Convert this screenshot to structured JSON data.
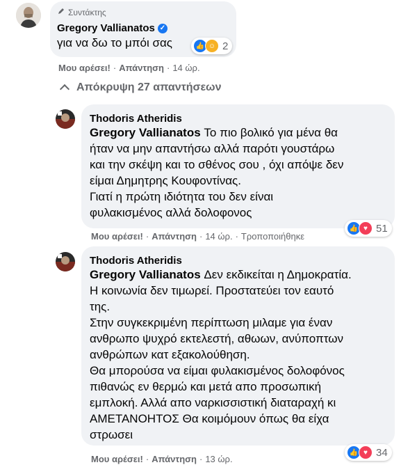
{
  "colors": {
    "bubble": "#f0f2f5",
    "meta": "#65676b",
    "like": "#1877f2",
    "love": "#f33e58",
    "care": "#f7b125"
  },
  "comment1": {
    "badge": "Συντάκτης",
    "author": "Gregory Vallianatos",
    "text": "για να δω το μπόι σας",
    "reactions_count": "2",
    "actions": {
      "like": "Μου αρέσει!",
      "reply": "Απάντηση",
      "time": "14 ώρ."
    }
  },
  "hide_replies": "Απόκρυψη 27 απαντήσεων",
  "reply1": {
    "author": "Thodoris Atheridis",
    "mention": "Gregory Vallianatos",
    "lines": [
      " Το πιο βολικό για μένα θα",
      "ήταν να μην απαντήσω αλλά παρότι γουστάρω",
      "και την σκέψη και το σθένος σου , όχι απόψε δεν",
      "είμαι Δημητρης Κουφοντίνας.",
      "Γιατί η πρώτη ιδιότητα του δεν είναι",
      "φυλακισμένος αλλά δολοφονος"
    ],
    "reactions_count": "51",
    "actions": {
      "like": "Μου αρέσει!",
      "reply": "Απάντηση",
      "time": "14 ώρ.",
      "edited": "Τροποποιήθηκε"
    }
  },
  "reply2": {
    "author": "Thodoris Atheridis",
    "mention": "Gregory Vallianatos",
    "lines": [
      " Δεν εκδικείται η Δημοκρατία.",
      "Η κοινωνία δεν τιμωρεί. Προστατεύει τον εαυτό",
      "της.",
      "Στην συγκεκριμένη περίπτωση μιλαμε για έναν",
      "ανθρωπο ψυχρό εκτελεστή, αθωων, ανύποπτων",
      "ανθρώπων κατ εξακολούθηση.",
      "Θα μπορούσα να είμαι φυλακισμένος δολοφόνος",
      "πιθανώς εν θερμώ και μετά απο προσωπική",
      "εμπλοκή. Αλλά απο ναρκισσιστική διαταραχή κι",
      "ΑΜΕΤΑΝΟΗΤΟΣ Θα κοιμόμουν όπως θα είχα",
      "στρωσει"
    ],
    "reactions_count": "34",
    "actions": {
      "like": "Μου αρέσει!",
      "reply": "Απάντηση",
      "time": "13 ώρ."
    }
  }
}
